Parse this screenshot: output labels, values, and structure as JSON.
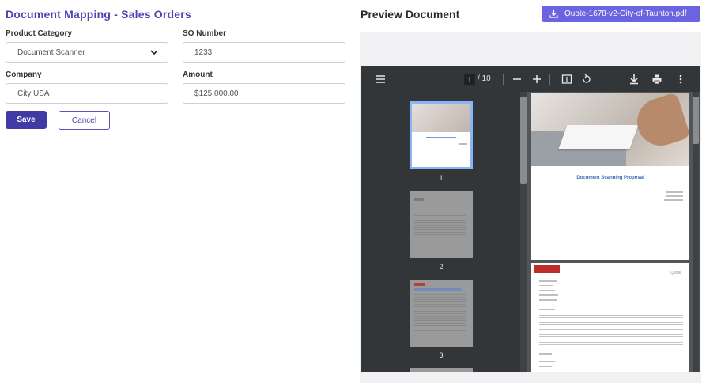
{
  "form": {
    "title": "Document Mapping - Sales Orders",
    "fields": {
      "product_category": {
        "label": "Product Category",
        "value": "Document Scanner"
      },
      "so_number": {
        "label": "SO Number",
        "value": "1233"
      },
      "company": {
        "label": "Company",
        "value": "City USA"
      },
      "amount": {
        "label": "Amount",
        "value": "$125,000.00"
      }
    },
    "save_label": "Save",
    "cancel_label": "Cancel"
  },
  "preview": {
    "title": "Preview Document",
    "download_label": "Quote-1678-v2-City-of-Taunton.pdf",
    "viewer": {
      "current_page": "1",
      "page_total": "/ 10",
      "thumbnails": [
        {
          "number": "1"
        },
        {
          "number": "2"
        },
        {
          "number": "3"
        }
      ],
      "page1": {
        "heading": "Document Scanning Proposal"
      },
      "page2": {
        "quote_label": "Quote"
      }
    }
  },
  "colors": {
    "accent": "#4a43b0",
    "button_primary": "#3f3aa6",
    "download_button": "#6a64e0",
    "viewer_toolbar": "#323639",
    "viewer_bg": "#525659"
  }
}
